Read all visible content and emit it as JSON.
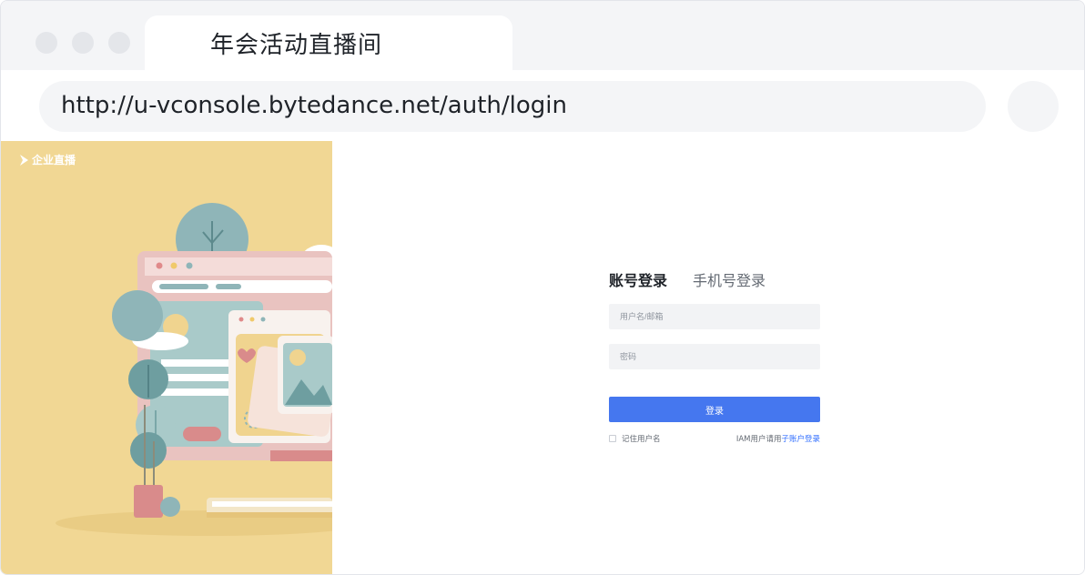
{
  "browser": {
    "tab_title": "年会活动直播间",
    "url": "http://u-vconsole.bytedance.net/auth/login"
  },
  "illustration": {
    "logo_text": "企业直播"
  },
  "login": {
    "tab_account": "账号登录",
    "tab_phone": "手机号登录",
    "username_placeholder": "用户名/邮箱",
    "password_placeholder": "密码",
    "submit_label": "登录",
    "remember_label": "记住用户名",
    "iam_prefix": "IAM用户请用",
    "iam_link": "子账户登录"
  },
  "colors": {
    "primary": "#4577ef",
    "illustration_bg": "#f0d48f",
    "chrome_bg": "#f4f5f7"
  }
}
